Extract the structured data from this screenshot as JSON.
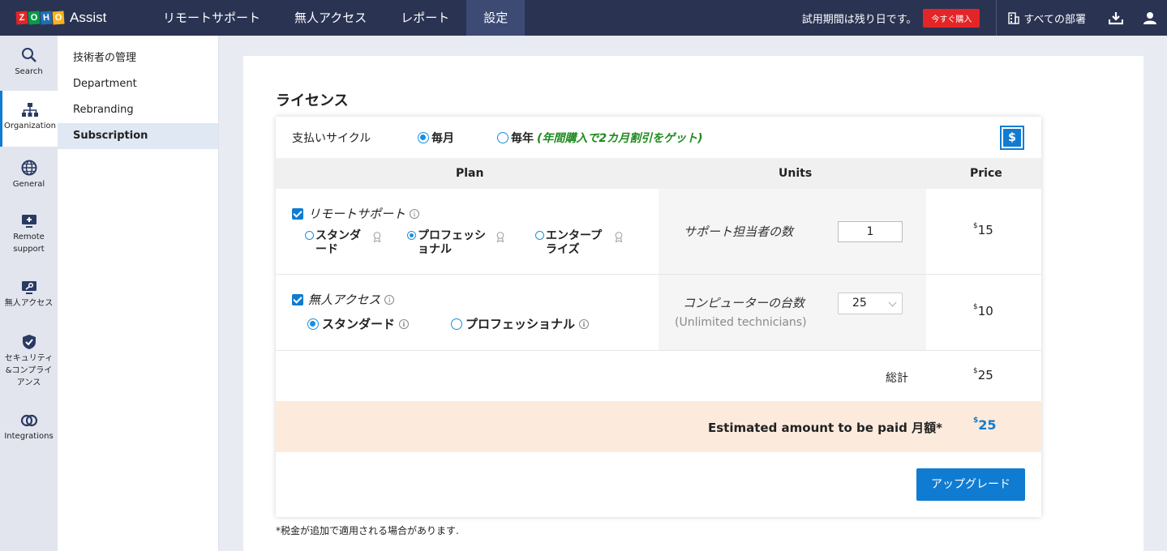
{
  "topbar": {
    "logo_letters": [
      "Z",
      "O",
      "H",
      "O"
    ],
    "product_name": "Assist",
    "nav": [
      "リモートサポート",
      "無人アクセス",
      "レポート",
      "設定"
    ],
    "active_nav": "設定",
    "trial_text": "試用期間は残り日です。",
    "buy_label": "今すぐ購入",
    "department_label": "すべての部署",
    "icons": [
      "building-icon",
      "download-icon",
      "user-icon"
    ]
  },
  "rail": {
    "items": [
      {
        "label": "Search",
        "icon": "search-icon"
      },
      {
        "label": "Organization",
        "icon": "organization-icon",
        "active": true
      },
      {
        "label": "General",
        "icon": "globe-icon"
      },
      {
        "label": "Remote support",
        "icon": "monitor-plus-icon"
      },
      {
        "label": "無人アクセス",
        "icon": "key-monitor-icon"
      },
      {
        "label": "セキュリティ&コンプライアンス",
        "icon": "shield-icon"
      },
      {
        "label": "Integrations",
        "icon": "integrations-icon"
      }
    ]
  },
  "submenu": {
    "items": [
      "技術者の管理",
      "Department",
      "Rebranding",
      "Subscription"
    ],
    "active": "Subscription"
  },
  "license": {
    "title": "ライセンス",
    "cycle_label": "支払いサイクル",
    "monthly_label": "毎月",
    "yearly_label": "毎年",
    "yearly_promo": "(年間購入で2カ月割引をゲット)",
    "selected_cycle": "monthly",
    "currency_symbol": "$",
    "headers": {
      "plan": "Plan",
      "units": "Units",
      "price": "Price"
    },
    "remote_support": {
      "name": "リモートサポート",
      "checked": true,
      "editions": [
        "スタンダード",
        "プロフェッショナル",
        "エンタープライズ"
      ],
      "selected_edition": "プロフェッショナル",
      "units_label": "サポート担当者の数",
      "units_value": "1",
      "price_symbol": "$",
      "price": "15"
    },
    "unattended_access": {
      "name": "無人アクセス",
      "checked": true,
      "editions": [
        "スタンダード",
        "プロフェッショナル"
      ],
      "selected_edition": "スタンダード",
      "units_label": "コンピューターの台数",
      "units_sub": "(Unlimited technicians)",
      "units_value": "25",
      "price_symbol": "$",
      "price": "10"
    },
    "total_label": "総計",
    "total_symbol": "$",
    "total": "25",
    "estimated_label": "Estimated amount to be paid 月額*",
    "estimated_symbol": "$",
    "estimated": "25",
    "upgrade_label": "アップグレード",
    "tax_note": "*税金が追加で適用される場合があります."
  },
  "colors": {
    "topbar": "#2a3352",
    "accent": "#0f7cd2",
    "buy": "#e42527",
    "promo": "#1f8b1f",
    "estimate_bg": "#fcebdc"
  }
}
